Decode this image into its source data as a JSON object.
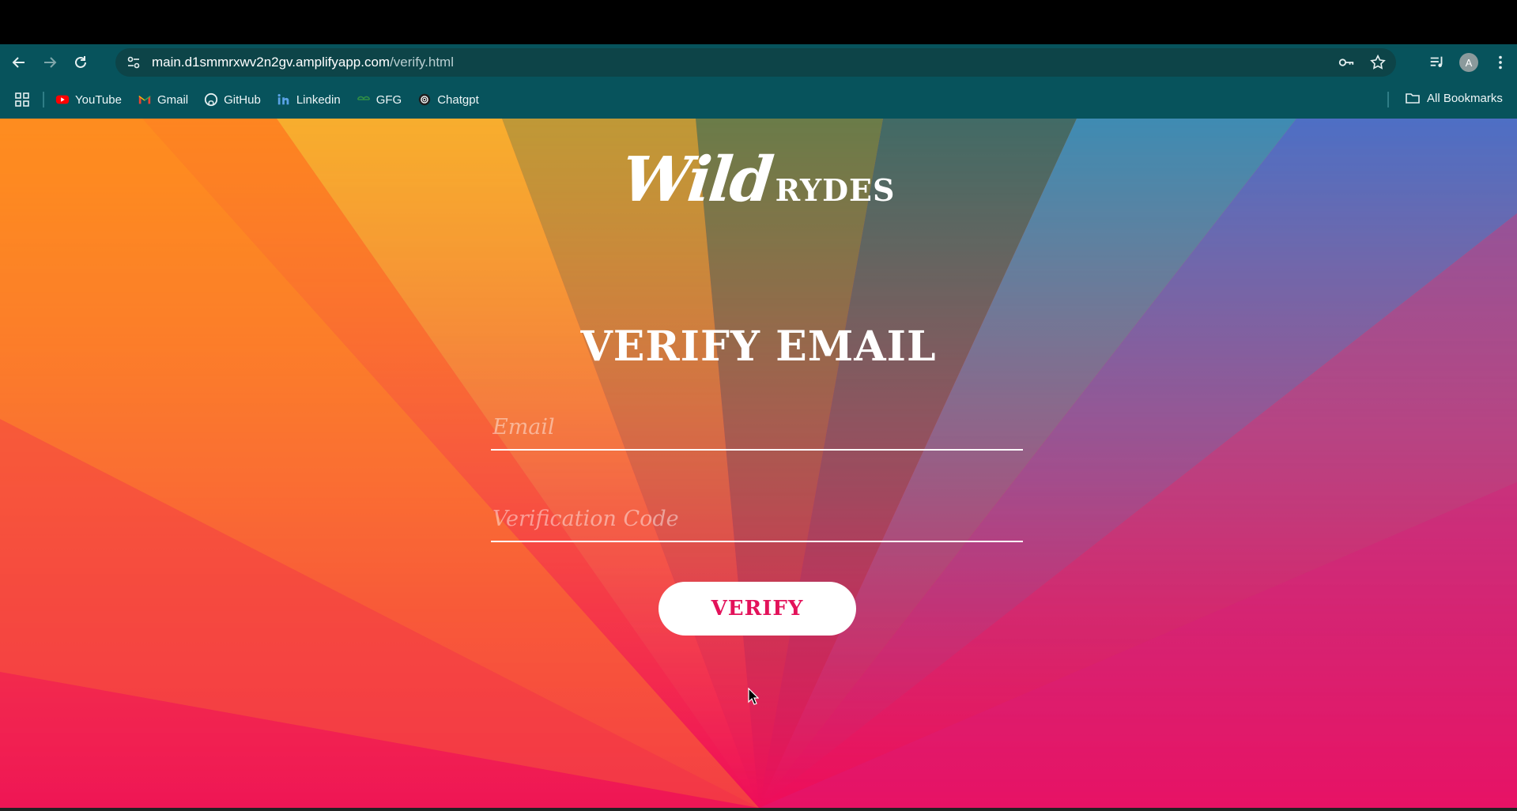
{
  "browser": {
    "url_domain": "main.d1smmrxwv2n2gv.amplifyapp.com",
    "url_path": "/verify.html",
    "avatar_letter": "A",
    "bookmarks": [
      {
        "label": "YouTube",
        "icon": "youtube-icon",
        "color": "#ff0000"
      },
      {
        "label": "Gmail",
        "icon": "gmail-icon",
        "color": "#ea4335"
      },
      {
        "label": "GitHub",
        "icon": "github-icon",
        "color": "#ffffff"
      },
      {
        "label": "Linkedin",
        "icon": "linkedin-icon",
        "color": "#0a66c2"
      },
      {
        "label": "GFG",
        "icon": "gfg-icon",
        "color": "#2f8d46"
      },
      {
        "label": "Chatgpt",
        "icon": "chatgpt-icon",
        "color": "#ffffff"
      }
    ],
    "all_bookmarks_label": "All Bookmarks",
    "toolbar_color": "#07535c"
  },
  "page": {
    "logo_wild": "Wild",
    "logo_rydes": "RYDES",
    "heading": "VERIFY EMAIL",
    "email_placeholder": "Email",
    "code_placeholder": "Verification Code",
    "verify_label": "VERIFY",
    "accent_color": "#e3125a"
  }
}
